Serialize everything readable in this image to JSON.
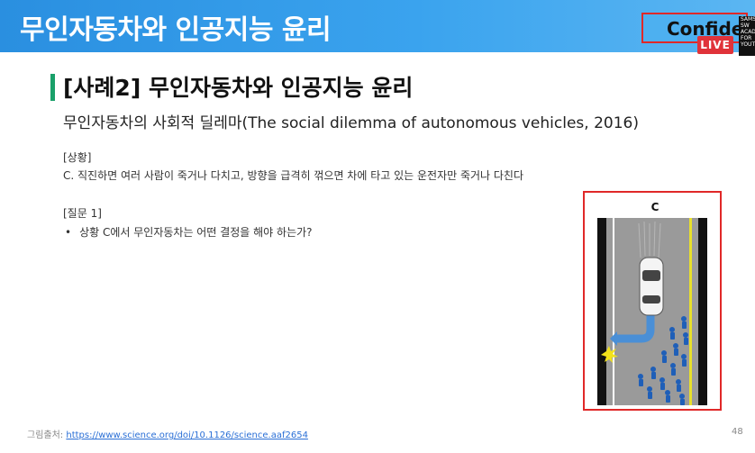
{
  "header": {
    "title": "무인자동차와 인공지능 윤리",
    "confidential": "Confider",
    "live": "LIVE",
    "corner_logo": "SAMSUNG SW ACADEMY FOR YOUTH"
  },
  "slide": {
    "heading": "[사례2] 무인자동차와 인공지능 윤리",
    "subtitle": "무인자동차의 사회적 딜레마(The social dilemma of autonomous vehicles, 2016)",
    "situation_label": "[상황]",
    "situation_text": "C.    직진하면 여러 사람이 죽거나 다치고, 방향을 급격히 꺾으면 차에 타고 있는 운전자만 죽거나 다친다",
    "question_label": "[질문 1]",
    "question_bullet": "•",
    "question_text": "상황 C에서 무인자동차는 어떤 결정을 해야 하는가?",
    "figure_label": "C"
  },
  "footer": {
    "credit_prefix": "그림출처: ",
    "credit_url": "https://www.science.org/doi/10.1126/science.aaf2654",
    "page_number": "48"
  },
  "colors": {
    "header_bg": "#3aa3ee",
    "accent_bar": "#1aa06a",
    "highlight_border": "#e02828",
    "pedestrian": "#1f5fb8",
    "lane_yellow": "#e8e02a",
    "path_arrow": "#4a8fd6"
  }
}
